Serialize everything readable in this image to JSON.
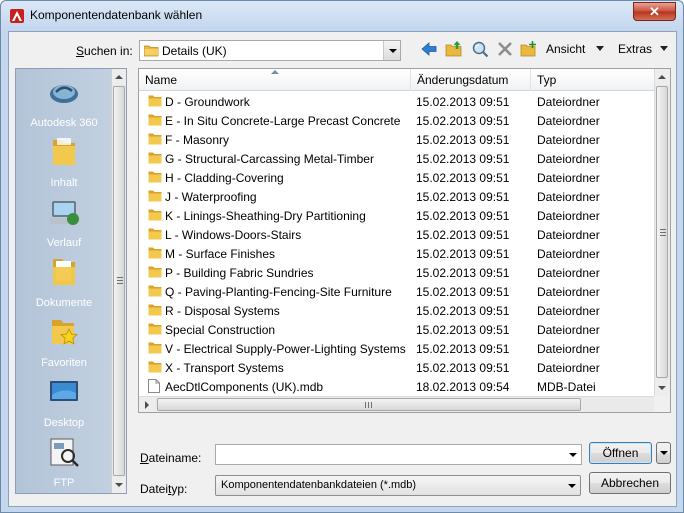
{
  "window": {
    "title": "Komponentendatenbank wählen",
    "close_glyph": "✕"
  },
  "toolbar": {
    "lookin_label_pre": "",
    "lookin_label_u": "S",
    "lookin_label_post": "uchen in:",
    "lookin_value": "Details (UK)",
    "ansicht_label": "Ansicht",
    "extras_label": "Extras"
  },
  "places": [
    {
      "label": "Autodesk 360",
      "icon": "cloud-icon"
    },
    {
      "label": "Inhalt",
      "icon": "folder-icon"
    },
    {
      "label": "Verlauf",
      "icon": "history-icon"
    },
    {
      "label": "Dokumente",
      "icon": "documents-icon"
    },
    {
      "label": "Favoriten",
      "icon": "favorites-icon"
    },
    {
      "label": "Desktop",
      "icon": "desktop-icon"
    },
    {
      "label": "FTP",
      "icon": "ftp-icon"
    }
  ],
  "columns": {
    "name": "Name",
    "date": "Änderungsdatum",
    "type": "Typ"
  },
  "files": [
    {
      "name": "D - Groundwork",
      "date": "15.02.2013 09:51",
      "type": "Dateiordner",
      "kind": "folder"
    },
    {
      "name": "E - In Situ Concrete-Large Precast Concrete",
      "date": "15.02.2013 09:51",
      "type": "Dateiordner",
      "kind": "folder"
    },
    {
      "name": "F - Masonry",
      "date": "15.02.2013 09:51",
      "type": "Dateiordner",
      "kind": "folder"
    },
    {
      "name": "G - Structural-Carcassing Metal-Timber",
      "date": "15.02.2013 09:51",
      "type": "Dateiordner",
      "kind": "folder"
    },
    {
      "name": "H - Cladding-Covering",
      "date": "15.02.2013 09:51",
      "type": "Dateiordner",
      "kind": "folder"
    },
    {
      "name": "J - Waterproofing",
      "date": "15.02.2013 09:51",
      "type": "Dateiordner",
      "kind": "folder"
    },
    {
      "name": "K - Linings-Sheathing-Dry Partitioning",
      "date": "15.02.2013 09:51",
      "type": "Dateiordner",
      "kind": "folder"
    },
    {
      "name": "L - Windows-Doors-Stairs",
      "date": "15.02.2013 09:51",
      "type": "Dateiordner",
      "kind": "folder"
    },
    {
      "name": "M - Surface Finishes",
      "date": "15.02.2013 09:51",
      "type": "Dateiordner",
      "kind": "folder"
    },
    {
      "name": "P - Building Fabric Sundries",
      "date": "15.02.2013 09:51",
      "type": "Dateiordner",
      "kind": "folder"
    },
    {
      "name": "Q - Paving-Planting-Fencing-Site Furniture",
      "date": "15.02.2013 09:51",
      "type": "Dateiordner",
      "kind": "folder"
    },
    {
      "name": "R - Disposal Systems",
      "date": "15.02.2013 09:51",
      "type": "Dateiordner",
      "kind": "folder"
    },
    {
      "name": "Special Construction",
      "date": "15.02.2013 09:51",
      "type": "Dateiordner",
      "kind": "folder"
    },
    {
      "name": "V - Electrical Supply-Power-Lighting Systems",
      "date": "15.02.2013 09:51",
      "type": "Dateiordner",
      "kind": "folder"
    },
    {
      "name": "X - Transport Systems",
      "date": "15.02.2013 09:51",
      "type": "Dateiordner",
      "kind": "folder"
    },
    {
      "name": "AecDtlComponents (UK).mdb",
      "date": "18.02.2013 09:54",
      "type": "MDB-Datei",
      "kind": "file"
    }
  ],
  "bottom": {
    "filename_label": "Dateiname:",
    "filename_value": "",
    "filetype_label": "Dateityp:",
    "filetype_value": "Komponentendatenbankdateien (*.mdb)",
    "open_label": "Öffnen",
    "cancel_label": "Abbrechen"
  },
  "colors": {
    "folder": "#e8b93c",
    "title_bg": "#c4d7ee",
    "places_bg": "#b3c4d8"
  }
}
